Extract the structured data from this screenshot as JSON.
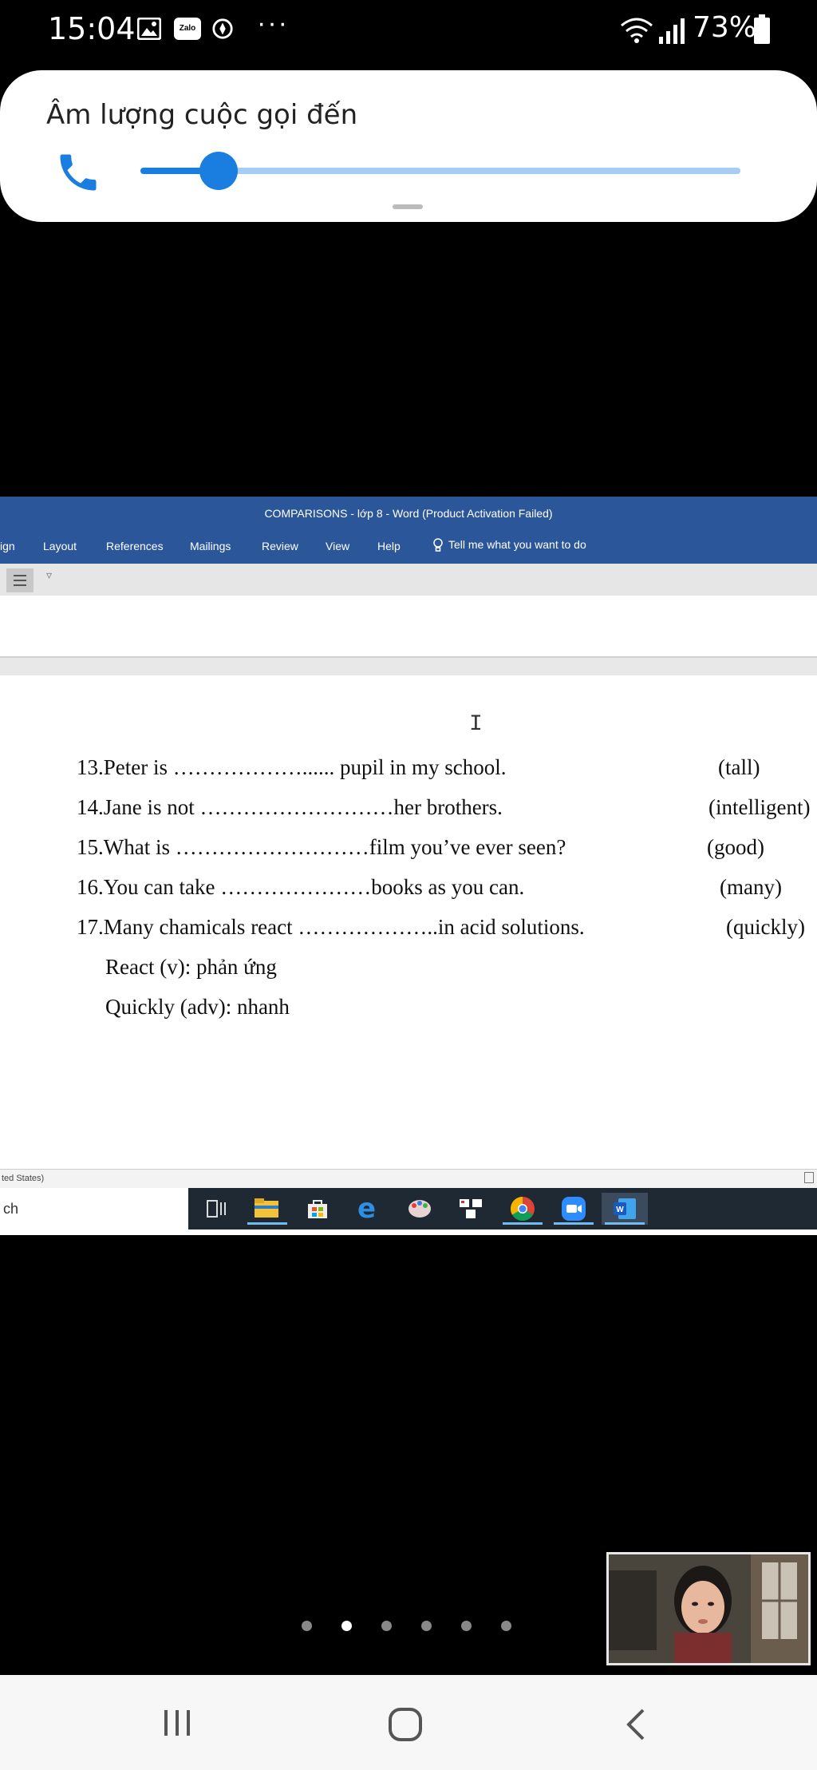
{
  "status_bar": {
    "time": "15:04",
    "icons": [
      "image-icon",
      "zalo-icon",
      "compass-icon"
    ],
    "zalo_text": "Zalo",
    "more": "···",
    "battery": "73%"
  },
  "volume_panel": {
    "title": "Âm lượng cuộc gọi đến",
    "level": 0.13,
    "accent": "#1a7de0"
  },
  "word": {
    "title": "COMPARISONS - lớp 8  -  Word (Product Activation Failed)",
    "ribbon_tabs": [
      "ign",
      "Layout",
      "References",
      "Mailings",
      "Review",
      "View",
      "Help"
    ],
    "tell_me": "Tell me what you want to do",
    "brand_color": "#2b579a",
    "lines": [
      {
        "text": "13.Peter is ………………...... pupil in my school.",
        "hint": "(tall)"
      },
      {
        "text": "14.Jane is not ………………………her brothers.",
        "hint": "(intelligent)"
      },
      {
        "text": "15.What is ………………………film you’ve ever seen?",
        "hint": "(good)"
      },
      {
        "text": "16.You can take …………………books as you can.",
        "hint": "(many)"
      },
      {
        "text": "17.Many chamicals react ………………..in acid solutions.",
        "hint": "(quickly)"
      },
      {
        "text": "React (v): phản ứng",
        "hint": ""
      },
      {
        "text": "Quickly (adv): nhanh",
        "hint": ""
      }
    ],
    "status_text": "ted States)",
    "taskbar_search": "ch"
  },
  "pager": {
    "count": 6,
    "active": 1
  }
}
